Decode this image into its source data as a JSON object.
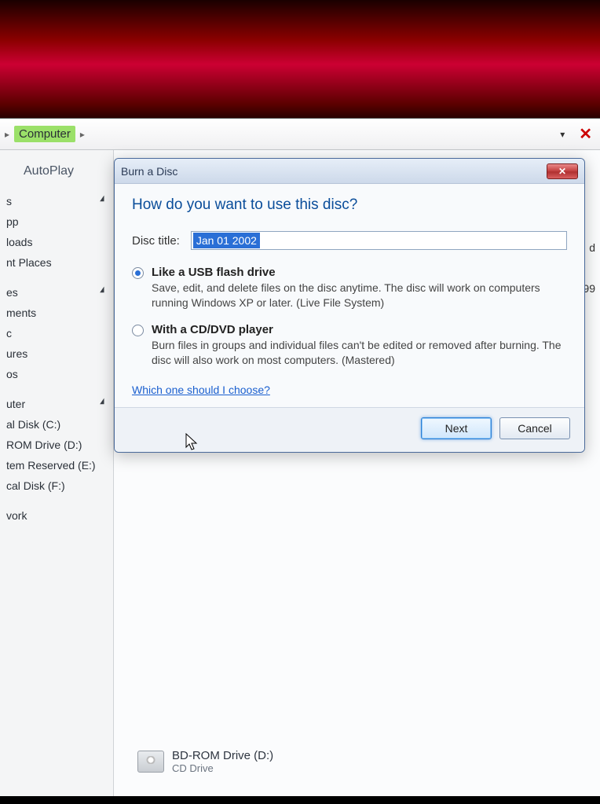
{
  "topbar": {
    "breadcrumb_arrow": "▸",
    "breadcrumb_current": "Computer",
    "dropdown_glyph": "▾",
    "close_glyph": "✕"
  },
  "sidebar": {
    "autoplay_tab": "AutoPlay",
    "items": [
      {
        "label": "s",
        "group_end": true
      },
      {
        "label": "pp"
      },
      {
        "label": "loads"
      },
      {
        "label": "nt Places"
      },
      {
        "spacer": true
      },
      {
        "label": "es",
        "group_end": true
      },
      {
        "label": "ments"
      },
      {
        "label": "c"
      },
      {
        "label": "ures"
      },
      {
        "label": "os"
      },
      {
        "spacer": true
      },
      {
        "label": "uter",
        "group_end": true
      },
      {
        "label": "al Disk (C:)"
      },
      {
        "label": "ROM Drive (D:)"
      },
      {
        "label": "tem Reserved (E:)"
      },
      {
        "label": "cal Disk (F:)"
      },
      {
        "spacer": true
      },
      {
        "label": "vork"
      }
    ]
  },
  "main": {
    "partial1": "d",
    "partial2": "99",
    "drive_title": "BD-ROM Drive (D:)",
    "drive_sub": "CD Drive"
  },
  "dialog": {
    "title": "Burn a Disc",
    "close_glyph": "✕",
    "heading": "How do you want to use this disc?",
    "disc_title_label": "Disc title:",
    "disc_title_value": "Jan 01 2002",
    "options": [
      {
        "checked": true,
        "title": "Like a USB flash drive",
        "desc": "Save, edit, and delete files on the disc anytime. The disc will work on computers running Windows XP or later. (Live File System)"
      },
      {
        "checked": false,
        "title": "With a CD/DVD player",
        "desc": "Burn files in groups and individual files can't be edited or removed after burning. The disc will also work on most computers. (Mastered)"
      }
    ],
    "help_link": "Which one should I choose?",
    "next_label": "Next",
    "cancel_label": "Cancel"
  }
}
